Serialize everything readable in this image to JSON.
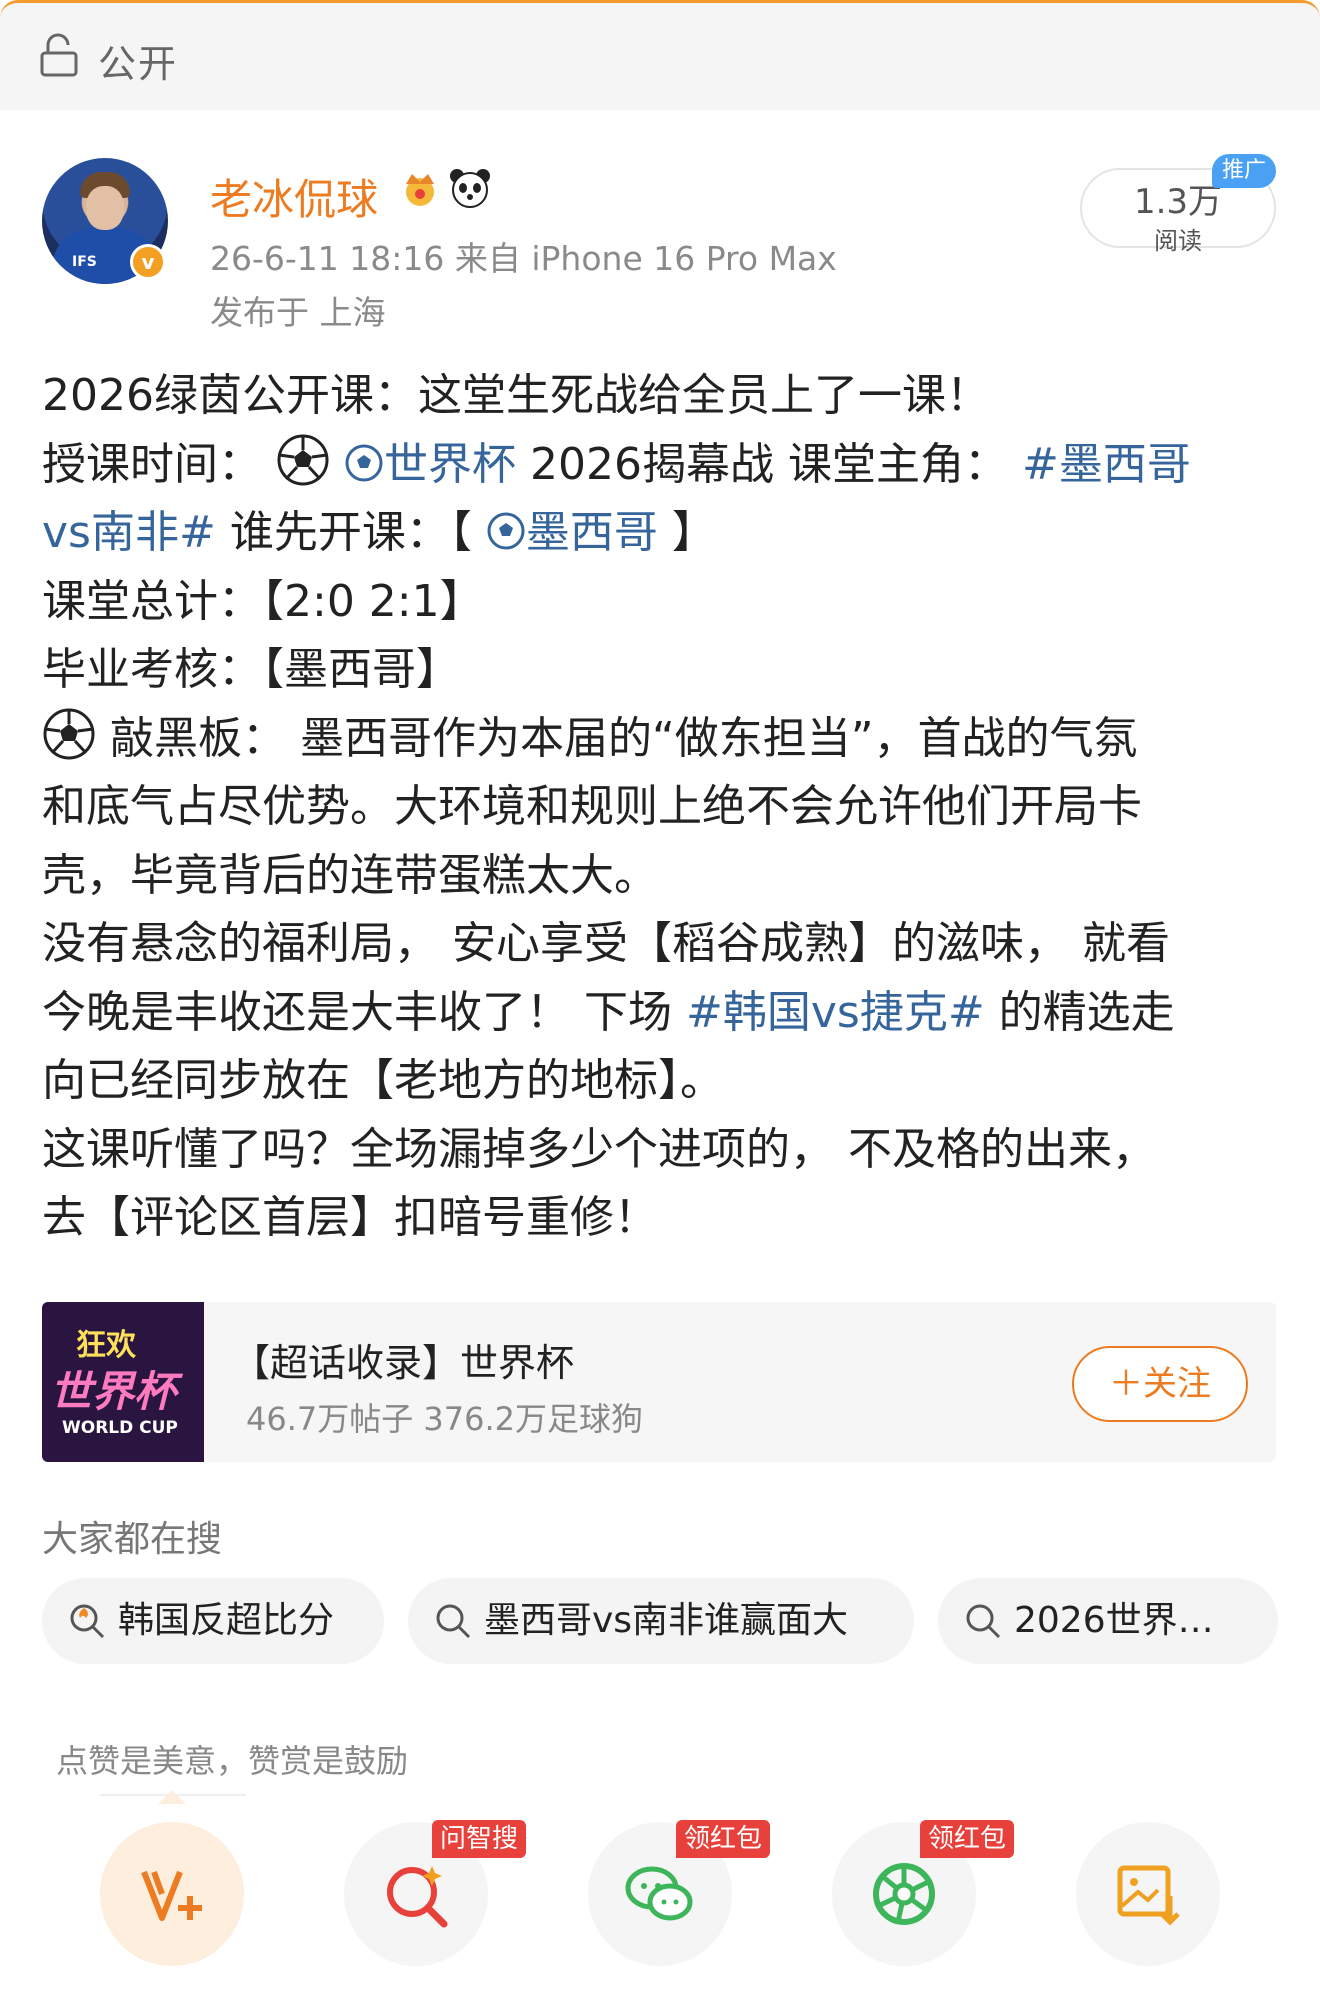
{
  "header": {
    "visibility_label": "公开"
  },
  "author": {
    "name": "老冰侃球",
    "time_source": "26-6-11 18:16  来自 iPhone 16 Pro Max",
    "location": "发布于 上海",
    "avatar_text": "IFS"
  },
  "reads": {
    "count": "1.3万",
    "label": "阅读",
    "promo": "推广"
  },
  "post": {
    "l1": "2026绿茵公开课：这堂生死战给全员上了一课！",
    "l2a": "授课时间：",
    "l2b": "世界杯",
    "l2c": "2026揭幕战 课堂主角：",
    "l2d": "#墨西哥",
    "l3a": "vs南非#",
    "l3b": " 谁先开课：【",
    "l3c": "墨西哥",
    "l3d": "】",
    "l4": "课堂总计：【2:0 2:1】",
    "l5": "毕业考核：【墨西哥】",
    "l6": " 敲黑板： 墨西哥作为本届的“做东担当”，首战的气氛",
    "l7": "和底气占尽优势。大环境和规则上绝不会允许他们开局卡",
    "l8": "壳，毕竟背后的连带蛋糕太大。",
    "l9": "没有悬念的福利局， 安心享受【稻谷成熟】的滋味， 就看",
    "l10a": "今晚是丰收还是大丰收了！ 下场 ",
    "l10b": "#韩国vs捷克#",
    "l10c": " 的精选走",
    "l11": "向已经同步放在【老地方的地标】。",
    "l12": "这课听懂了吗？全场漏掉多少个进项的， 不及格的出来，",
    "l13": "去【评论区首层】扣暗号重修！"
  },
  "topic": {
    "thumb_top": "狂欢",
    "thumb_main": "世界杯",
    "thumb_sub": "WORLD CUP",
    "title": "【超话收录】世界杯",
    "stats": "46.7万帖子 376.2万足球狗",
    "follow_label": "＋关注"
  },
  "searches": {
    "heading": "大家都在搜",
    "items": [
      "韩国反超比分",
      "墨西哥vs南非谁赢面大",
      "2026世界…"
    ]
  },
  "actions": {
    "tip": "点赞是美意，赞赏是鼓励",
    "tags": [
      "问智搜",
      "领红包",
      "领红包"
    ]
  },
  "colors": {
    "accent": "#ec7b21",
    "link": "#36659c",
    "badge_red": "#e8403a",
    "promo_blue": "#4aa0f2"
  }
}
